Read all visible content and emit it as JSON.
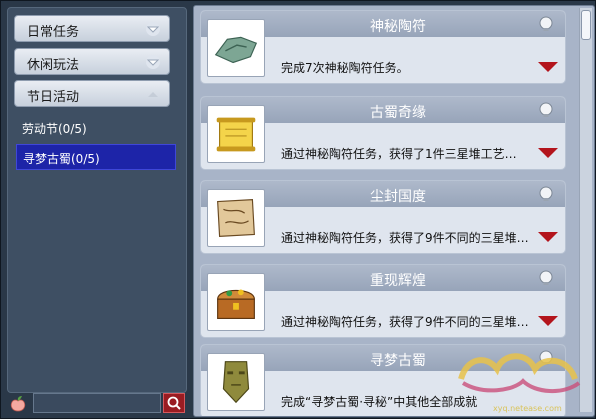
{
  "categories": [
    {
      "label": "日常任务",
      "expanded": false
    },
    {
      "label": "休闲玩法",
      "expanded": false
    },
    {
      "label": "节日活动",
      "expanded": true
    }
  ],
  "festival_items": [
    {
      "label": "劳动节(0/5)",
      "active": false
    },
    {
      "label": "寻梦古蜀(0/5)",
      "active": true
    }
  ],
  "search": {
    "placeholder": "",
    "value": ""
  },
  "tasks": [
    {
      "title": "神秘陶符",
      "desc": "完成7次神秘陶符任务。",
      "icon": "jade-talisman-icon"
    },
    {
      "title": "古蜀奇缘",
      "desc": "通过神秘陶符任务，获得了1件三星堆工艺…",
      "icon": "golden-scroll-icon"
    },
    {
      "title": "尘封国度",
      "desc": "通过神秘陶符任务，获得了9件不同的三星堆…",
      "icon": "ancient-map-icon"
    },
    {
      "title": "重现辉煌",
      "desc": "通过神秘陶符任务，获得了9件不同的三星堆…",
      "icon": "treasure-chest-icon"
    },
    {
      "title": "寻梦古蜀",
      "desc": "完成“寻梦古蜀·寻秘”中其他全部成就",
      "icon": "bronze-mask-icon"
    }
  ],
  "watermark": {
    "text": "xyq.netease.com"
  },
  "colors": {
    "active_item": "#1d24a8",
    "expand_arrow": "#b3141c",
    "search_button": "#9a1c22"
  }
}
